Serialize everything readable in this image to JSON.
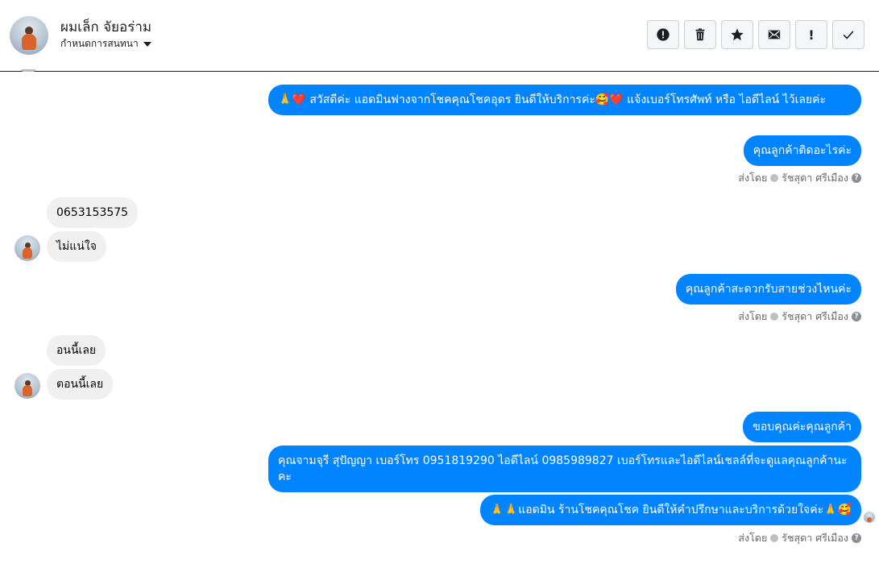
{
  "header": {
    "contact_name": "ผมเล็ก จัยอร่าม",
    "conversation_label": "กำหนดการสนทนา",
    "toolbar": {
      "spam_icon": "alert-circle-icon",
      "delete_icon": "trash-icon",
      "star_icon": "star-icon",
      "mail_icon": "envelope-icon",
      "important_label": "!",
      "done_icon": "check-icon"
    }
  },
  "colors": {
    "outgoing_bubble": "#0084ff",
    "incoming_bubble": "#f0f0f0",
    "meta_text": "#65676b"
  },
  "messages": [
    {
      "dir": "out",
      "text": "🙏❤️ สวัสดีค่ะ แอดมินฟางจากโชคคุณโชคอุดร ยินดีให้บริการค่ะ🥰❤️ แจ้งเบอร์โทรศัพท์ หรือ ไอดีไลน์  ไว้เลยค่ะ"
    },
    {
      "dir": "out",
      "text": "คุณลูกค้าติดอะไรค่ะ"
    },
    {
      "dir": "meta",
      "sent_by": "ส่งโดย",
      "agent": "รัชสุดา ศรีเมือง"
    },
    {
      "dir": "in",
      "text": "0653153575"
    },
    {
      "dir": "in",
      "text": "ไม่แน่ใจ"
    },
    {
      "dir": "out",
      "text": "คุณลูกค้าสะดวกรับสายช่วงไหนค่ะ"
    },
    {
      "dir": "meta",
      "sent_by": "ส่งโดย",
      "agent": "รัชสุดา ศรีเมือง"
    },
    {
      "dir": "in",
      "text": "อนนี้เลย"
    },
    {
      "dir": "in",
      "text": "ตอนนี้เลย"
    },
    {
      "dir": "out",
      "text": "ขอบคุณค่ะคุณลูกค้า"
    },
    {
      "dir": "out",
      "text": "คุณจามจุรี สุปัญญา เบอร์โทร 0951819290  ไอดีไลน์ 0985989827  เบอร์โทรและไอดีไลน์เชลล์ที่จะดูแลคุณลูกค้านะคะ"
    },
    {
      "dir": "out",
      "text": "🙏🙏แอดมิน ร้านโชคคุณโชค ยินดีให้คำปรึกษาและบริการด้วยใจค่ะ🙏🥰"
    },
    {
      "dir": "meta",
      "sent_by": "ส่งโดย",
      "agent": "รัชสุดา ศรีเมือง"
    }
  ]
}
